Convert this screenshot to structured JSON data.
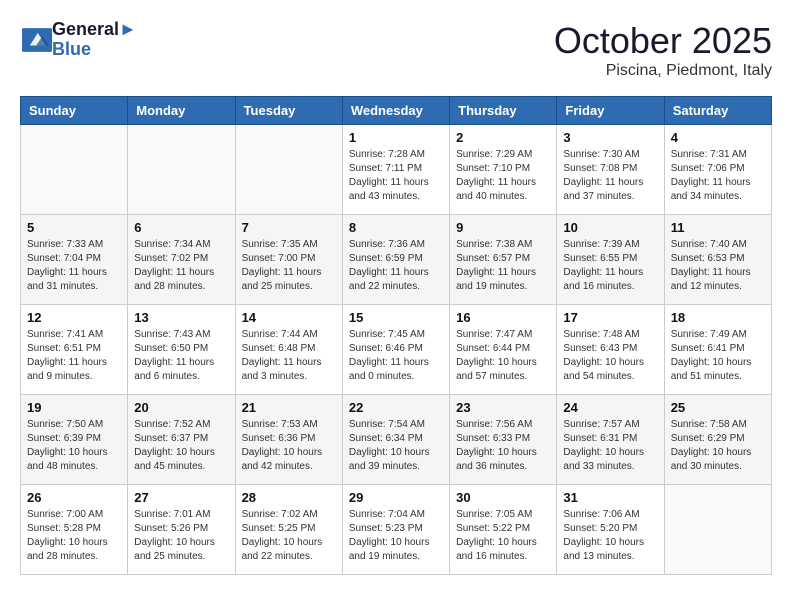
{
  "header": {
    "logo_line1": "General",
    "logo_line2": "Blue",
    "month": "October 2025",
    "location": "Piscina, Piedmont, Italy"
  },
  "weekdays": [
    "Sunday",
    "Monday",
    "Tuesday",
    "Wednesday",
    "Thursday",
    "Friday",
    "Saturday"
  ],
  "weeks": [
    [
      {
        "day": "",
        "detail": ""
      },
      {
        "day": "",
        "detail": ""
      },
      {
        "day": "",
        "detail": ""
      },
      {
        "day": "1",
        "detail": "Sunrise: 7:28 AM\nSunset: 7:11 PM\nDaylight: 11 hours\nand 43 minutes."
      },
      {
        "day": "2",
        "detail": "Sunrise: 7:29 AM\nSunset: 7:10 PM\nDaylight: 11 hours\nand 40 minutes."
      },
      {
        "day": "3",
        "detail": "Sunrise: 7:30 AM\nSunset: 7:08 PM\nDaylight: 11 hours\nand 37 minutes."
      },
      {
        "day": "4",
        "detail": "Sunrise: 7:31 AM\nSunset: 7:06 PM\nDaylight: 11 hours\nand 34 minutes."
      }
    ],
    [
      {
        "day": "5",
        "detail": "Sunrise: 7:33 AM\nSunset: 7:04 PM\nDaylight: 11 hours\nand 31 minutes."
      },
      {
        "day": "6",
        "detail": "Sunrise: 7:34 AM\nSunset: 7:02 PM\nDaylight: 11 hours\nand 28 minutes."
      },
      {
        "day": "7",
        "detail": "Sunrise: 7:35 AM\nSunset: 7:00 PM\nDaylight: 11 hours\nand 25 minutes."
      },
      {
        "day": "8",
        "detail": "Sunrise: 7:36 AM\nSunset: 6:59 PM\nDaylight: 11 hours\nand 22 minutes."
      },
      {
        "day": "9",
        "detail": "Sunrise: 7:38 AM\nSunset: 6:57 PM\nDaylight: 11 hours\nand 19 minutes."
      },
      {
        "day": "10",
        "detail": "Sunrise: 7:39 AM\nSunset: 6:55 PM\nDaylight: 11 hours\nand 16 minutes."
      },
      {
        "day": "11",
        "detail": "Sunrise: 7:40 AM\nSunset: 6:53 PM\nDaylight: 11 hours\nand 12 minutes."
      }
    ],
    [
      {
        "day": "12",
        "detail": "Sunrise: 7:41 AM\nSunset: 6:51 PM\nDaylight: 11 hours\nand 9 minutes."
      },
      {
        "day": "13",
        "detail": "Sunrise: 7:43 AM\nSunset: 6:50 PM\nDaylight: 11 hours\nand 6 minutes."
      },
      {
        "day": "14",
        "detail": "Sunrise: 7:44 AM\nSunset: 6:48 PM\nDaylight: 11 hours\nand 3 minutes."
      },
      {
        "day": "15",
        "detail": "Sunrise: 7:45 AM\nSunset: 6:46 PM\nDaylight: 11 hours\nand 0 minutes."
      },
      {
        "day": "16",
        "detail": "Sunrise: 7:47 AM\nSunset: 6:44 PM\nDaylight: 10 hours\nand 57 minutes."
      },
      {
        "day": "17",
        "detail": "Sunrise: 7:48 AM\nSunset: 6:43 PM\nDaylight: 10 hours\nand 54 minutes."
      },
      {
        "day": "18",
        "detail": "Sunrise: 7:49 AM\nSunset: 6:41 PM\nDaylight: 10 hours\nand 51 minutes."
      }
    ],
    [
      {
        "day": "19",
        "detail": "Sunrise: 7:50 AM\nSunset: 6:39 PM\nDaylight: 10 hours\nand 48 minutes."
      },
      {
        "day": "20",
        "detail": "Sunrise: 7:52 AM\nSunset: 6:37 PM\nDaylight: 10 hours\nand 45 minutes."
      },
      {
        "day": "21",
        "detail": "Sunrise: 7:53 AM\nSunset: 6:36 PM\nDaylight: 10 hours\nand 42 minutes."
      },
      {
        "day": "22",
        "detail": "Sunrise: 7:54 AM\nSunset: 6:34 PM\nDaylight: 10 hours\nand 39 minutes."
      },
      {
        "day": "23",
        "detail": "Sunrise: 7:56 AM\nSunset: 6:33 PM\nDaylight: 10 hours\nand 36 minutes."
      },
      {
        "day": "24",
        "detail": "Sunrise: 7:57 AM\nSunset: 6:31 PM\nDaylight: 10 hours\nand 33 minutes."
      },
      {
        "day": "25",
        "detail": "Sunrise: 7:58 AM\nSunset: 6:29 PM\nDaylight: 10 hours\nand 30 minutes."
      }
    ],
    [
      {
        "day": "26",
        "detail": "Sunrise: 7:00 AM\nSunset: 5:28 PM\nDaylight: 10 hours\nand 28 minutes."
      },
      {
        "day": "27",
        "detail": "Sunrise: 7:01 AM\nSunset: 5:26 PM\nDaylight: 10 hours\nand 25 minutes."
      },
      {
        "day": "28",
        "detail": "Sunrise: 7:02 AM\nSunset: 5:25 PM\nDaylight: 10 hours\nand 22 minutes."
      },
      {
        "day": "29",
        "detail": "Sunrise: 7:04 AM\nSunset: 5:23 PM\nDaylight: 10 hours\nand 19 minutes."
      },
      {
        "day": "30",
        "detail": "Sunrise: 7:05 AM\nSunset: 5:22 PM\nDaylight: 10 hours\nand 16 minutes."
      },
      {
        "day": "31",
        "detail": "Sunrise: 7:06 AM\nSunset: 5:20 PM\nDaylight: 10 hours\nand 13 minutes."
      },
      {
        "day": "",
        "detail": ""
      }
    ]
  ]
}
